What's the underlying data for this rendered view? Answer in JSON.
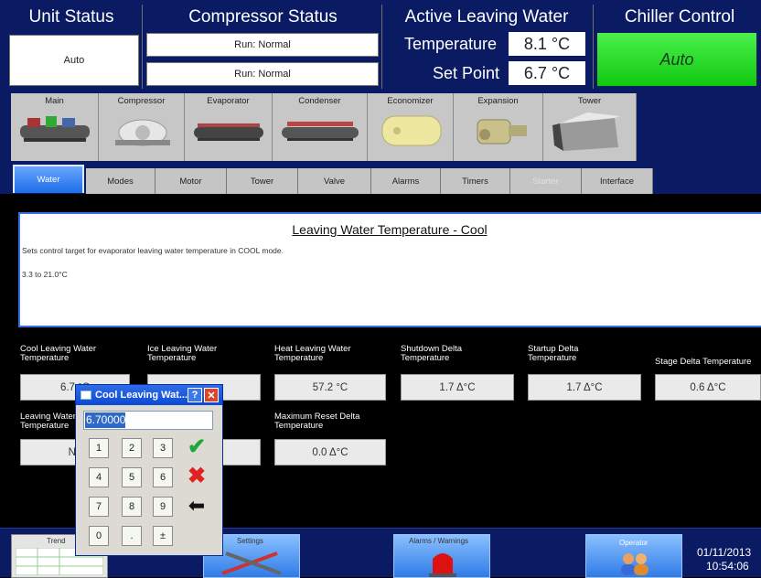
{
  "header": {
    "unit_status": {
      "title": "Unit Status",
      "value": "Auto"
    },
    "compressor_status": {
      "title": "Compressor Status",
      "value1": "Run: Normal",
      "value2": "Run: Normal"
    },
    "active_leaving_water": {
      "title": "Active Leaving Water",
      "temp_label": "Temperature",
      "temp_value": "8.1 °C",
      "setpoint_label": "Set Point",
      "setpoint_value": "6.7 °C"
    },
    "chiller_control": {
      "title": "Chiller Control",
      "value": "Auto",
      "color": "#1ee01e"
    }
  },
  "components": [
    "Main",
    "Compressor",
    "Evaporator",
    "Condenser",
    "Economizer",
    "Expansion",
    "Tower"
  ],
  "tabs": [
    {
      "label": "Water",
      "active": true
    },
    {
      "label": "Modes"
    },
    {
      "label": "Motor"
    },
    {
      "label": "Tower"
    },
    {
      "label": "Valve"
    },
    {
      "label": "Alarms"
    },
    {
      "label": "Timers"
    },
    {
      "label": "Starter",
      "disabled": true
    },
    {
      "label": "Interface"
    }
  ],
  "description": {
    "title": "Leaving Water Temperature - Cool",
    "text": "Sets control target for evaporator leaving water temperature in COOL mode.",
    "range": "3.3 to 21.0°C"
  },
  "params_row1": [
    {
      "label": "Cool Leaving Water Temperature",
      "value": "6.7 °C"
    },
    {
      "label": "Ice Leaving Water Temperature",
      "value": ""
    },
    {
      "label": "Heat Leaving Water Temperature",
      "value": "57.2 °C"
    },
    {
      "label": "Shutdown Delta Temperature",
      "value": "1.7 Δ°C"
    },
    {
      "label": "Startup Delta Temperature",
      "value": "1.7 Δ°C"
    },
    {
      "label": "Stage Delta Temperature",
      "value": "0.6 Δ°C"
    }
  ],
  "params_row2": [
    {
      "label": "Leaving Water Temperature",
      "value": "No"
    },
    {
      "label": "",
      "value": ""
    },
    {
      "label": "Maximum Reset Delta Temperature",
      "value": "0.0 Δ°C"
    }
  ],
  "keypad": {
    "title": "Cool Leaving Wat...",
    "input_value": "6.70000",
    "keys": [
      "1",
      "2",
      "3",
      "4",
      "5",
      "6",
      "7",
      "8",
      "9",
      "0",
      ".",
      "±"
    ]
  },
  "bottom_nav": {
    "trend": "Trend",
    "settings": "Settings",
    "alarms": "Alarms / Warnings",
    "operator": "Operator",
    "date": "01/11/2013",
    "time": "10:54:06"
  }
}
